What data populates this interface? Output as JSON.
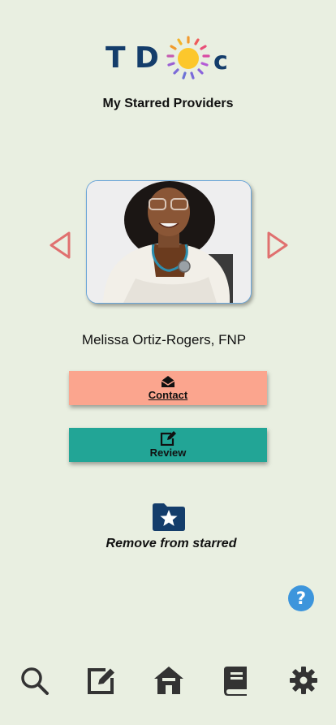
{
  "app": {
    "logo_text": "TDoc",
    "logo_brand_color": "#143d6b"
  },
  "page": {
    "title": "My Starred Providers"
  },
  "provider": {
    "name": "Melissa Ortiz-Rogers, FNP",
    "photo_alt": "Melissa Ortiz-Rogers, FNP"
  },
  "carousel": {
    "prev_icon": "triangle-left-outline",
    "next_icon": "triangle-right-outline",
    "arrow_color": "#e0706f"
  },
  "actions": {
    "contact_label": "Contact",
    "contact_icon": "envelope-open-icon",
    "contact_color": "#fba58e",
    "review_label": "Review",
    "review_icon": "edit-icon",
    "review_color": "#22a596",
    "remove_label": "Remove from starred",
    "remove_icon": "starred-folder-icon",
    "remove_icon_color": "#143d6b"
  },
  "help": {
    "label": "?",
    "color": "#3d95dc"
  },
  "bottom_nav": [
    {
      "icon": "search-icon"
    },
    {
      "icon": "edit-icon"
    },
    {
      "icon": "home-icon"
    },
    {
      "icon": "book-icon"
    },
    {
      "icon": "gear-icon"
    }
  ]
}
